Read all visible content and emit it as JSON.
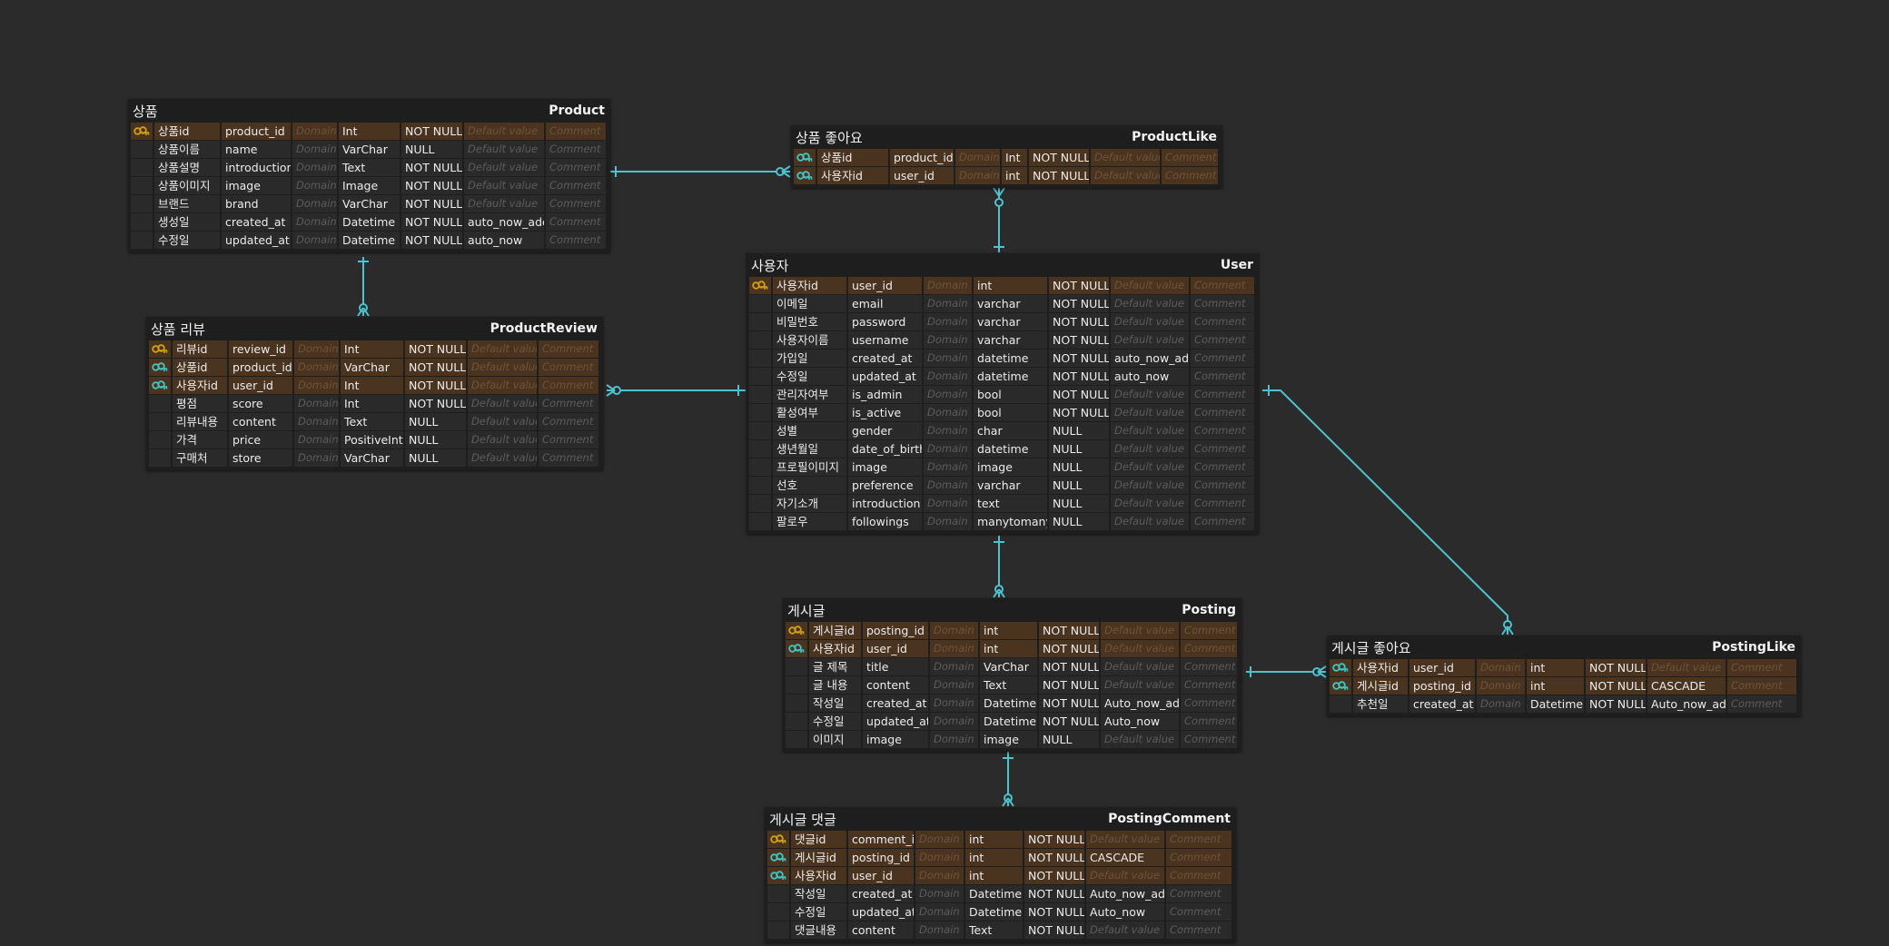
{
  "placeholders": {
    "domain": "Domain",
    "default": "Default value",
    "comment": "Comment"
  },
  "colors": {
    "background": "#2b2b2b",
    "entity": "#1e1e1e",
    "key_row": "#4a3420",
    "pk_icon": "#d4a017",
    "fk_icon": "#3ec7c7",
    "link": "#4dc3cf"
  },
  "entities": {
    "product": {
      "logical": "상품",
      "physical": "Product",
      "columns": [
        {
          "key": "pk",
          "logical": "상품id",
          "name": "product_id",
          "type": "Int",
          "nullable": "NOT NULL",
          "default": ""
        },
        {
          "key": "",
          "logical": "상품이름",
          "name": "name",
          "type": "VarChar",
          "nullable": "NULL",
          "default": ""
        },
        {
          "key": "",
          "logical": "상품설명",
          "name": "introduction",
          "type": "Text",
          "nullable": "NOT NULL",
          "default": ""
        },
        {
          "key": "",
          "logical": "상품이미지",
          "name": "image",
          "type": "Image",
          "nullable": "NOT NULL",
          "default": ""
        },
        {
          "key": "",
          "logical": "브랜드",
          "name": "brand",
          "type": "VarChar",
          "nullable": "NOT NULL",
          "default": ""
        },
        {
          "key": "",
          "logical": "생성일",
          "name": "created_at",
          "type": "Datetime",
          "nullable": "NOT NULL",
          "default": "auto_now_add"
        },
        {
          "key": "",
          "logical": "수정일",
          "name": "updated_at",
          "type": "Datetime",
          "nullable": "NOT NULL",
          "default": "auto_now"
        }
      ]
    },
    "product_like": {
      "logical": "상품 좋아요",
      "physical": "ProductLike",
      "columns": [
        {
          "key": "fk",
          "logical": "상품id",
          "name": "product_id",
          "type": "Int",
          "nullable": "NOT NULL",
          "default": ""
        },
        {
          "key": "fk",
          "logical": "사용자id",
          "name": "user_id",
          "type": "int",
          "nullable": "NOT NULL",
          "default": ""
        }
      ]
    },
    "product_review": {
      "logical": "상품 리뷰",
      "physical": "ProductReview",
      "columns": [
        {
          "key": "pk",
          "logical": "리뷰id",
          "name": "review_id",
          "type": "Int",
          "nullable": "NOT NULL",
          "default": ""
        },
        {
          "key": "fk",
          "logical": "상품id",
          "name": "product_id",
          "type": "VarChar",
          "nullable": "NOT NULL",
          "default": ""
        },
        {
          "key": "fk",
          "logical": "사용자id",
          "name": "user_id",
          "type": "Int",
          "nullable": "NOT NULL",
          "default": ""
        },
        {
          "key": "",
          "logical": "평점",
          "name": "score",
          "type": "Int",
          "nullable": "NOT NULL",
          "default": ""
        },
        {
          "key": "",
          "logical": "리뷰내용",
          "name": "content",
          "type": "Text",
          "nullable": "NULL",
          "default": ""
        },
        {
          "key": "",
          "logical": "가격",
          "name": "price",
          "type": "PositiveInt",
          "nullable": "NULL",
          "default": ""
        },
        {
          "key": "",
          "logical": "구매처",
          "name": "store",
          "type": "VarChar",
          "nullable": "NULL",
          "default": ""
        }
      ]
    },
    "user": {
      "logical": "사용자",
      "physical": "User",
      "columns": [
        {
          "key": "pk",
          "logical": "사용자id",
          "name": "user_id",
          "type": "int",
          "nullable": "NOT NULL",
          "default": ""
        },
        {
          "key": "",
          "logical": "이메일",
          "name": "email",
          "type": "varchar",
          "nullable": "NOT NULL",
          "default": ""
        },
        {
          "key": "",
          "logical": "비밀번호",
          "name": "password",
          "type": "varchar",
          "nullable": "NOT NULL",
          "default": ""
        },
        {
          "key": "",
          "logical": "사용자이름",
          "name": "username",
          "type": "varchar",
          "nullable": "NOT NULL",
          "default": ""
        },
        {
          "key": "",
          "logical": "가입일",
          "name": "created_at",
          "type": "datetime",
          "nullable": "NOT NULL",
          "default": "auto_now_add"
        },
        {
          "key": "",
          "logical": "수정일",
          "name": "updated_at",
          "type": "datetime",
          "nullable": "NOT NULL",
          "default": "auto_now"
        },
        {
          "key": "",
          "logical": "관리자여부",
          "name": "is_admin",
          "type": "bool",
          "nullable": "NOT NULL",
          "default": ""
        },
        {
          "key": "",
          "logical": "활성여부",
          "name": "is_active",
          "type": "bool",
          "nullable": "NOT NULL",
          "default": ""
        },
        {
          "key": "",
          "logical": "성별",
          "name": "gender",
          "type": "char",
          "nullable": "NULL",
          "default": ""
        },
        {
          "key": "",
          "logical": "생년월일",
          "name": "date_of_birth",
          "type": "datetime",
          "nullable": "NULL",
          "default": ""
        },
        {
          "key": "",
          "logical": "프로필이미지",
          "name": "image",
          "type": "image",
          "nullable": "NULL",
          "default": ""
        },
        {
          "key": "",
          "logical": "선호",
          "name": "preference",
          "type": "varchar",
          "nullable": "NULL",
          "default": ""
        },
        {
          "key": "",
          "logical": "자기소개",
          "name": "introduction",
          "type": "text",
          "nullable": "NULL",
          "default": ""
        },
        {
          "key": "",
          "logical": "팔로우",
          "name": "followings",
          "type": "manytomany",
          "nullable": "NULL",
          "default": ""
        }
      ]
    },
    "posting": {
      "logical": "게시글",
      "physical": "Posting",
      "columns": [
        {
          "key": "pk",
          "logical": "게시글id",
          "name": "posting_id",
          "type": "int",
          "nullable": "NOT NULL",
          "default": ""
        },
        {
          "key": "fk",
          "logical": "사용자id",
          "name": "user_id",
          "type": "int",
          "nullable": "NOT NULL",
          "default": ""
        },
        {
          "key": "",
          "logical": "글 제목",
          "name": "title",
          "type": "VarChar",
          "nullable": "NOT NULL",
          "default": ""
        },
        {
          "key": "",
          "logical": "글 내용",
          "name": "content",
          "type": "Text",
          "nullable": "NOT NULL",
          "default": ""
        },
        {
          "key": "",
          "logical": "작성일",
          "name": "created_at",
          "type": "Datetime",
          "nullable": "NOT NULL",
          "default": "Auto_now_add"
        },
        {
          "key": "",
          "logical": "수정일",
          "name": "updated_at",
          "type": "Datetime",
          "nullable": "NOT NULL",
          "default": "Auto_now"
        },
        {
          "key": "",
          "logical": "이미지",
          "name": "image",
          "type": "image",
          "nullable": "NULL",
          "default": ""
        }
      ]
    },
    "posting_like": {
      "logical": "게시글 좋아요",
      "physical": "PostingLike",
      "columns": [
        {
          "key": "fk",
          "logical": "사용자id",
          "name": "user_id",
          "type": "int",
          "nullable": "NOT NULL",
          "default": ""
        },
        {
          "key": "fk",
          "logical": "게시글id",
          "name": "posting_id",
          "type": "int",
          "nullable": "NOT NULL",
          "default": "CASCADE"
        },
        {
          "key": "",
          "logical": "추천일",
          "name": "created_at",
          "type": "Datetime",
          "nullable": "NOT NULL",
          "default": "Auto_now_add"
        }
      ]
    },
    "posting_comment": {
      "logical": "게시글 댓글",
      "physical": "PostingComment",
      "columns": [
        {
          "key": "pk",
          "logical": "댓글id",
          "name": "comment_id",
          "type": "int",
          "nullable": "NOT NULL",
          "default": ""
        },
        {
          "key": "fk",
          "logical": "게시글id",
          "name": "posting_id",
          "type": "int",
          "nullable": "NOT NULL",
          "default": "CASCADE"
        },
        {
          "key": "fk",
          "logical": "사용자id",
          "name": "user_id",
          "type": "int",
          "nullable": "NOT NULL",
          "default": ""
        },
        {
          "key": "",
          "logical": "작성일",
          "name": "created_at",
          "type": "Datetime",
          "nullable": "NOT NULL",
          "default": "Auto_now_add"
        },
        {
          "key": "",
          "logical": "수정일",
          "name": "updated_at",
          "type": "Datetime",
          "nullable": "NOT NULL",
          "default": "Auto_now"
        },
        {
          "key": "",
          "logical": "댓글내용",
          "name": "content",
          "type": "Text",
          "nullable": "NOT NULL",
          "default": ""
        }
      ]
    }
  }
}
